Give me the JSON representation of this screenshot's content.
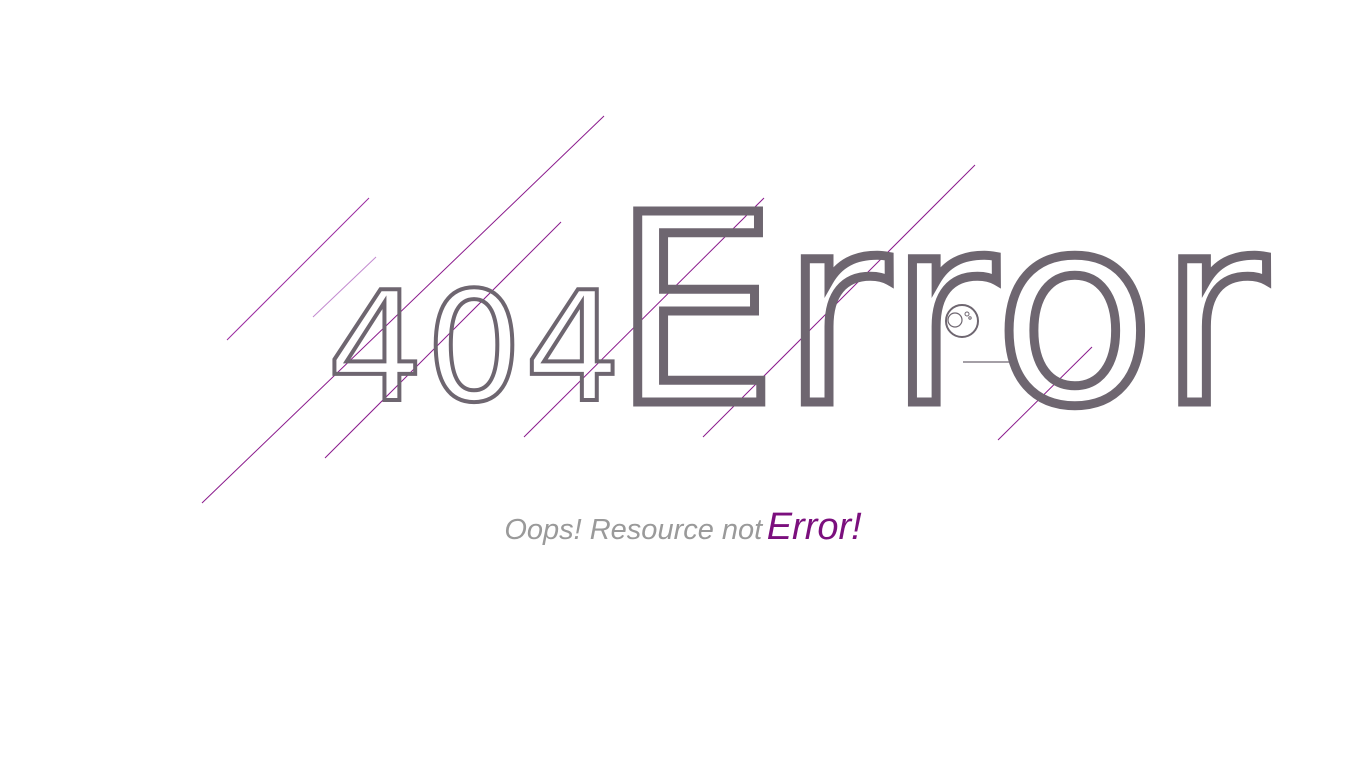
{
  "headline": {
    "code": "404",
    "word": "Error"
  },
  "subtitle": {
    "lead": "Oops! Resource not",
    "accent": "Error!"
  },
  "colors": {
    "text": "#6e6670",
    "accent": "#7b0f7d",
    "muted": "#9a9a9a",
    "streak": "#8a1a8c"
  }
}
